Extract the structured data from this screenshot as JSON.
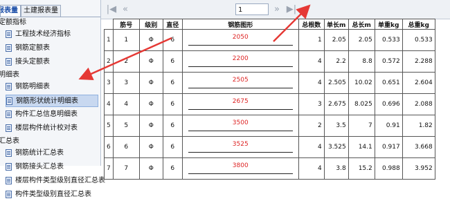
{
  "left_panel": {
    "tabs": [
      {
        "label": "报表量"
      },
      {
        "label": "土建报表量"
      }
    ],
    "groups": [
      {
        "label": "定额指标",
        "items": [
          "工程技术经济指标",
          "钢筋定额表",
          "接头定额表"
        ]
      },
      {
        "label": "明细表",
        "items": [
          "钢筋明细表",
          "钢筋形状统计明细表",
          "构件汇总信息明细表",
          "楼层构件统计校对表"
        ]
      },
      {
        "label": "汇总表",
        "items": [
          "钢筋统计汇总表",
          "钢筋接头汇总表",
          "楼层构件类型级别直径汇总表",
          "构件类型级别直径汇总表"
        ]
      }
    ],
    "selected_item": "钢筋形状统计明细表"
  },
  "toolbar": {
    "first_icon": "first-page-icon",
    "prev_icon": "prev-page-icon",
    "page_value": "1",
    "next_icon": "next-page-icon",
    "last_icon": "last-page-icon"
  },
  "table": {
    "headers": [
      "筋号",
      "级别",
      "直径",
      "钢筋图形",
      "总根数",
      "单长m",
      "总长m",
      "单重kg",
      "总重kg"
    ],
    "rows": [
      {
        "row": "1",
        "no": "1",
        "grade": "Φ",
        "dia": "6",
        "shape": "2050",
        "count": "1",
        "unit_len": "2.05",
        "total_len": "2.05",
        "unit_wt": "0.533",
        "total_wt": "0.533"
      },
      {
        "row": "2",
        "no": "2",
        "grade": "Φ",
        "dia": "6",
        "shape": "2200",
        "count": "4",
        "unit_len": "2.2",
        "total_len": "8.8",
        "unit_wt": "0.572",
        "total_wt": "2.288"
      },
      {
        "row": "3",
        "no": "3",
        "grade": "Φ",
        "dia": "6",
        "shape": "2505",
        "count": "4",
        "unit_len": "2.505",
        "total_len": "10.02",
        "unit_wt": "0.651",
        "total_wt": "2.604"
      },
      {
        "row": "4",
        "no": "4",
        "grade": "Φ",
        "dia": "6",
        "shape": "2675",
        "count": "3",
        "unit_len": "2.675",
        "total_len": "8.025",
        "unit_wt": "0.696",
        "total_wt": "2.088"
      },
      {
        "row": "5",
        "no": "5",
        "grade": "Φ",
        "dia": "6",
        "shape": "3500",
        "count": "2",
        "unit_len": "3.5",
        "total_len": "7",
        "unit_wt": "0.91",
        "total_wt": "1.82"
      },
      {
        "row": "6",
        "no": "6",
        "grade": "Φ",
        "dia": "6",
        "shape": "3525",
        "count": "4",
        "unit_len": "3.525",
        "total_len": "14.1",
        "unit_wt": "0.917",
        "total_wt": "3.668"
      },
      {
        "row": "7",
        "no": "7",
        "grade": "Φ",
        "dia": "6",
        "shape": "3800",
        "count": "4",
        "unit_len": "3.8",
        "total_len": "15.2",
        "unit_wt": "0.988",
        "total_wt": "3.952"
      }
    ]
  },
  "annotation_color": "#e53935"
}
